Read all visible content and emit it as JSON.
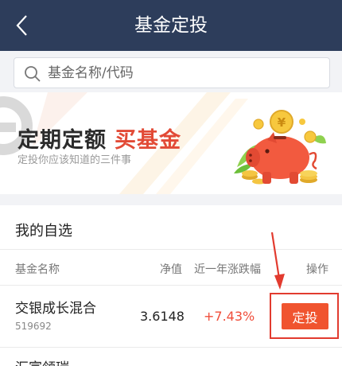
{
  "header": {
    "title": "基金定投",
    "back_icon": "chevron-left-icon"
  },
  "search": {
    "placeholder": "基金名称/代码",
    "icon": "search-icon"
  },
  "banner": {
    "title_part1": "定期定额",
    "title_part2": "买基金",
    "subtitle": "定投你应该知道的三件事",
    "coin_symbol": "¥"
  },
  "watchlist": {
    "title": "我的自选",
    "columns": {
      "name": "基金名称",
      "nav": "净值",
      "change": "近一年涨跌幅",
      "action": "操作"
    },
    "rows": [
      {
        "name": "交银成长混合",
        "code": "519692",
        "nav": "3.6148",
        "change": "+7.43%",
        "action_label": "定投"
      },
      {
        "name": "汇富领瑞"
      }
    ]
  },
  "colors": {
    "header_bg": "#2d3d5b",
    "accent_red": "#f0542f",
    "change_red": "#f04d3a"
  }
}
